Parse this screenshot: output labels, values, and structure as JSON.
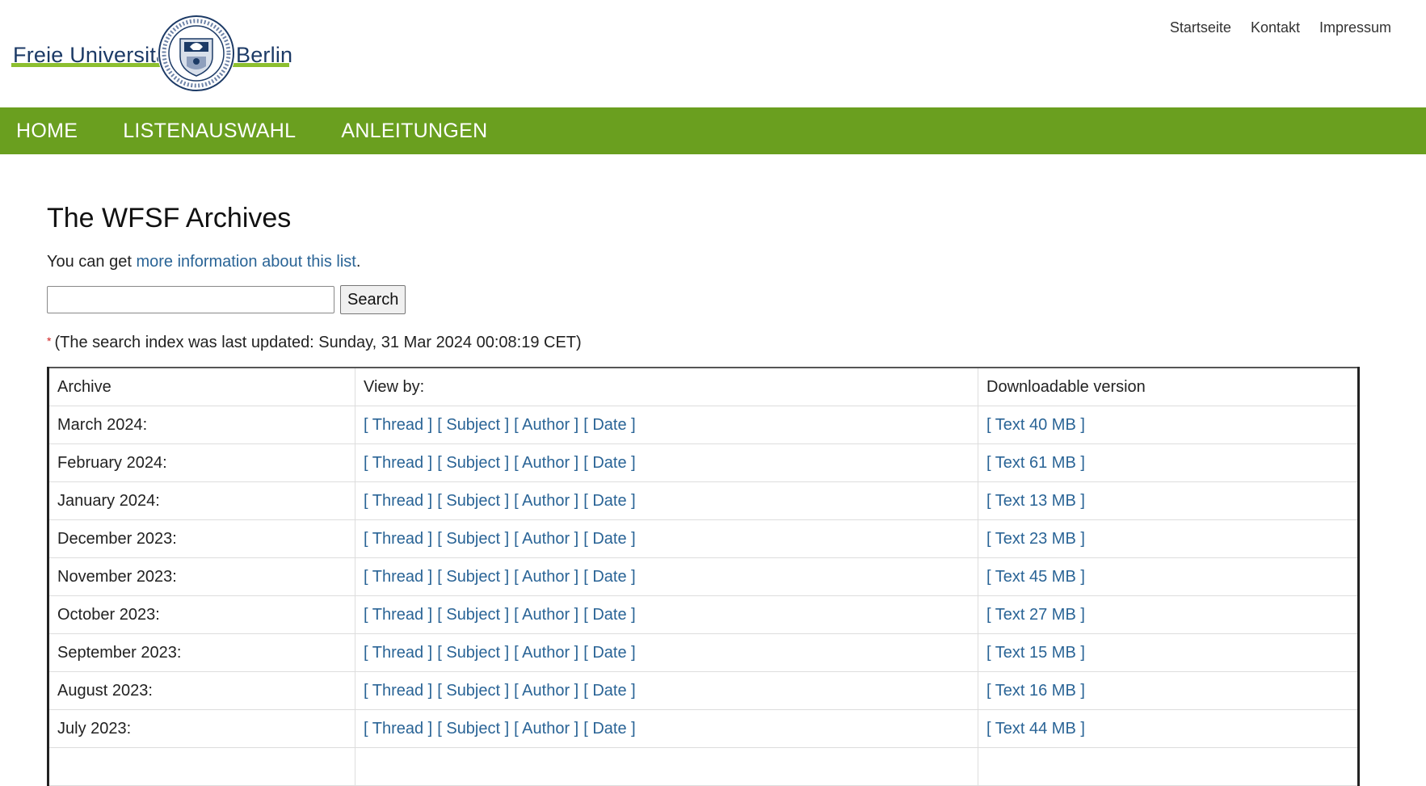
{
  "header": {
    "logo": {
      "left_word": "Freie Universität",
      "right_word": "Berlin"
    },
    "service_nav": [
      "Startseite",
      "Kontakt",
      "Impressum"
    ]
  },
  "main_nav": [
    "HOME",
    "LISTENAUSWAHL",
    "ANLEITUNGEN"
  ],
  "page": {
    "title": "The WFSF Archives",
    "info_prefix": "You can get ",
    "info_link": "more information about this list",
    "info_suffix": ".",
    "search": {
      "value": "",
      "placeholder": "",
      "button_label": "Search"
    },
    "index_note": {
      "asterisk": "*",
      "text": "(The search index was last updated: Sunday, 31 Mar 2024 00:08:19 CET)"
    }
  },
  "table": {
    "headers": {
      "archive": "Archive",
      "view_by": "View by:",
      "download": "Downloadable version"
    },
    "view_links": [
      "[ Thread ]",
      "[ Subject ]",
      "[ Author ]",
      "[ Date ]"
    ],
    "rows": [
      {
        "month": "March 2024:",
        "download": "[ Text 40 MB ]"
      },
      {
        "month": "February 2024:",
        "download": "[ Text 61 MB ]"
      },
      {
        "month": "January 2024:",
        "download": "[ Text 13 MB ]"
      },
      {
        "month": "December 2023:",
        "download": "[ Text 23 MB ]"
      },
      {
        "month": "November 2023:",
        "download": "[ Text 45 MB ]"
      },
      {
        "month": "October 2023:",
        "download": "[ Text 27 MB ]"
      },
      {
        "month": "September 2023:",
        "download": "[ Text 15 MB ]"
      },
      {
        "month": "August 2023:",
        "download": "[ Text 16 MB ]"
      },
      {
        "month": "July 2023:",
        "download": "[ Text 44 MB ]"
      }
    ]
  },
  "colors": {
    "nav_green": "#6a9f1f",
    "logo_green": "#8cbf2f",
    "logo_blue": "#1c3a66",
    "link_blue": "#2a6496"
  }
}
